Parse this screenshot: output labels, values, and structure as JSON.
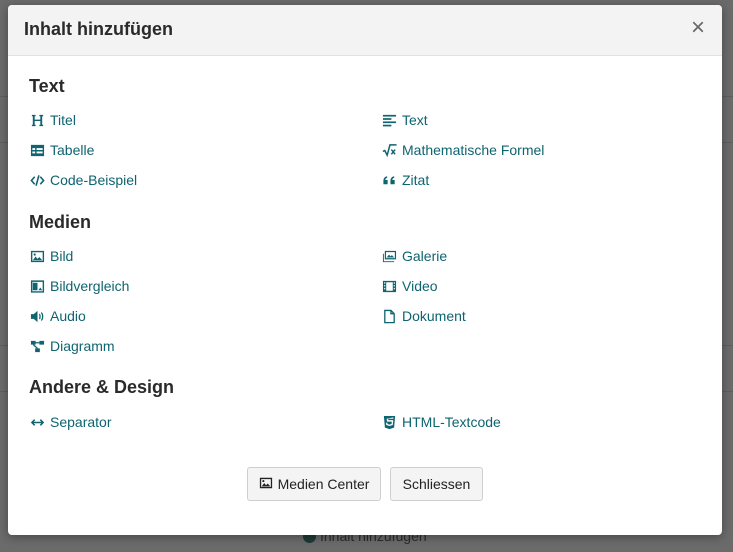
{
  "modal": {
    "title": "Inhalt hinzufügen",
    "close_symbol": "×"
  },
  "sections": [
    {
      "title": "Text",
      "items": [
        {
          "label": "Titel",
          "icon": "heading-icon"
        },
        {
          "label": "Text",
          "icon": "align-left-icon"
        },
        {
          "label": "Tabelle",
          "icon": "table-icon"
        },
        {
          "label": "Mathematische Formel",
          "icon": "square-root-icon"
        },
        {
          "label": "Code-Beispiel",
          "icon": "code-icon"
        },
        {
          "label": "Zitat",
          "icon": "quote-icon"
        }
      ]
    },
    {
      "title": "Medien",
      "items": [
        {
          "label": "Bild",
          "icon": "image-icon"
        },
        {
          "label": "Galerie",
          "icon": "images-icon"
        },
        {
          "label": "Bildvergleich",
          "icon": "image-compare-icon"
        },
        {
          "label": "Video",
          "icon": "film-icon"
        },
        {
          "label": "Audio",
          "icon": "volume-icon"
        },
        {
          "label": "Dokument",
          "icon": "file-icon"
        },
        {
          "label": "Diagramm",
          "icon": "diagram-icon"
        }
      ]
    },
    {
      "title": "Andere & Design",
      "items": [
        {
          "label": "Separator",
          "icon": "arrows-horizontal-icon"
        },
        {
          "label": "HTML-Textcode",
          "icon": "html5-icon"
        }
      ]
    }
  ],
  "footer": {
    "media_center_label": "Medien Center",
    "close_label": "Schliessen"
  },
  "background": {
    "add_content_label": "Inhalt hinzufügen"
  },
  "colors": {
    "accent": "#0e6470",
    "overlay": "#6b6b6b"
  }
}
